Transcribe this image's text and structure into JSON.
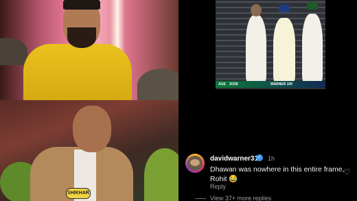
{
  "top_left": {},
  "bottom_left": {
    "badge_text": "SHIKHAR"
  },
  "broadcast": {
    "score_team": "AUS",
    "score_value": "3/199",
    "batter_name": "WARNER 100"
  },
  "comment": {
    "username": "davidwarner31",
    "verified_icon": "verified-badge-icon",
    "time": "1h",
    "text": "Dhawan was nowhere in this entire frame, Rohit 😂",
    "reply_label": "Reply",
    "view_more": "View 37+ more replies",
    "like_icon": "heart-icon",
    "colors": {
      "verified": "#3897f0",
      "muted": "#9aa0a6"
    }
  }
}
